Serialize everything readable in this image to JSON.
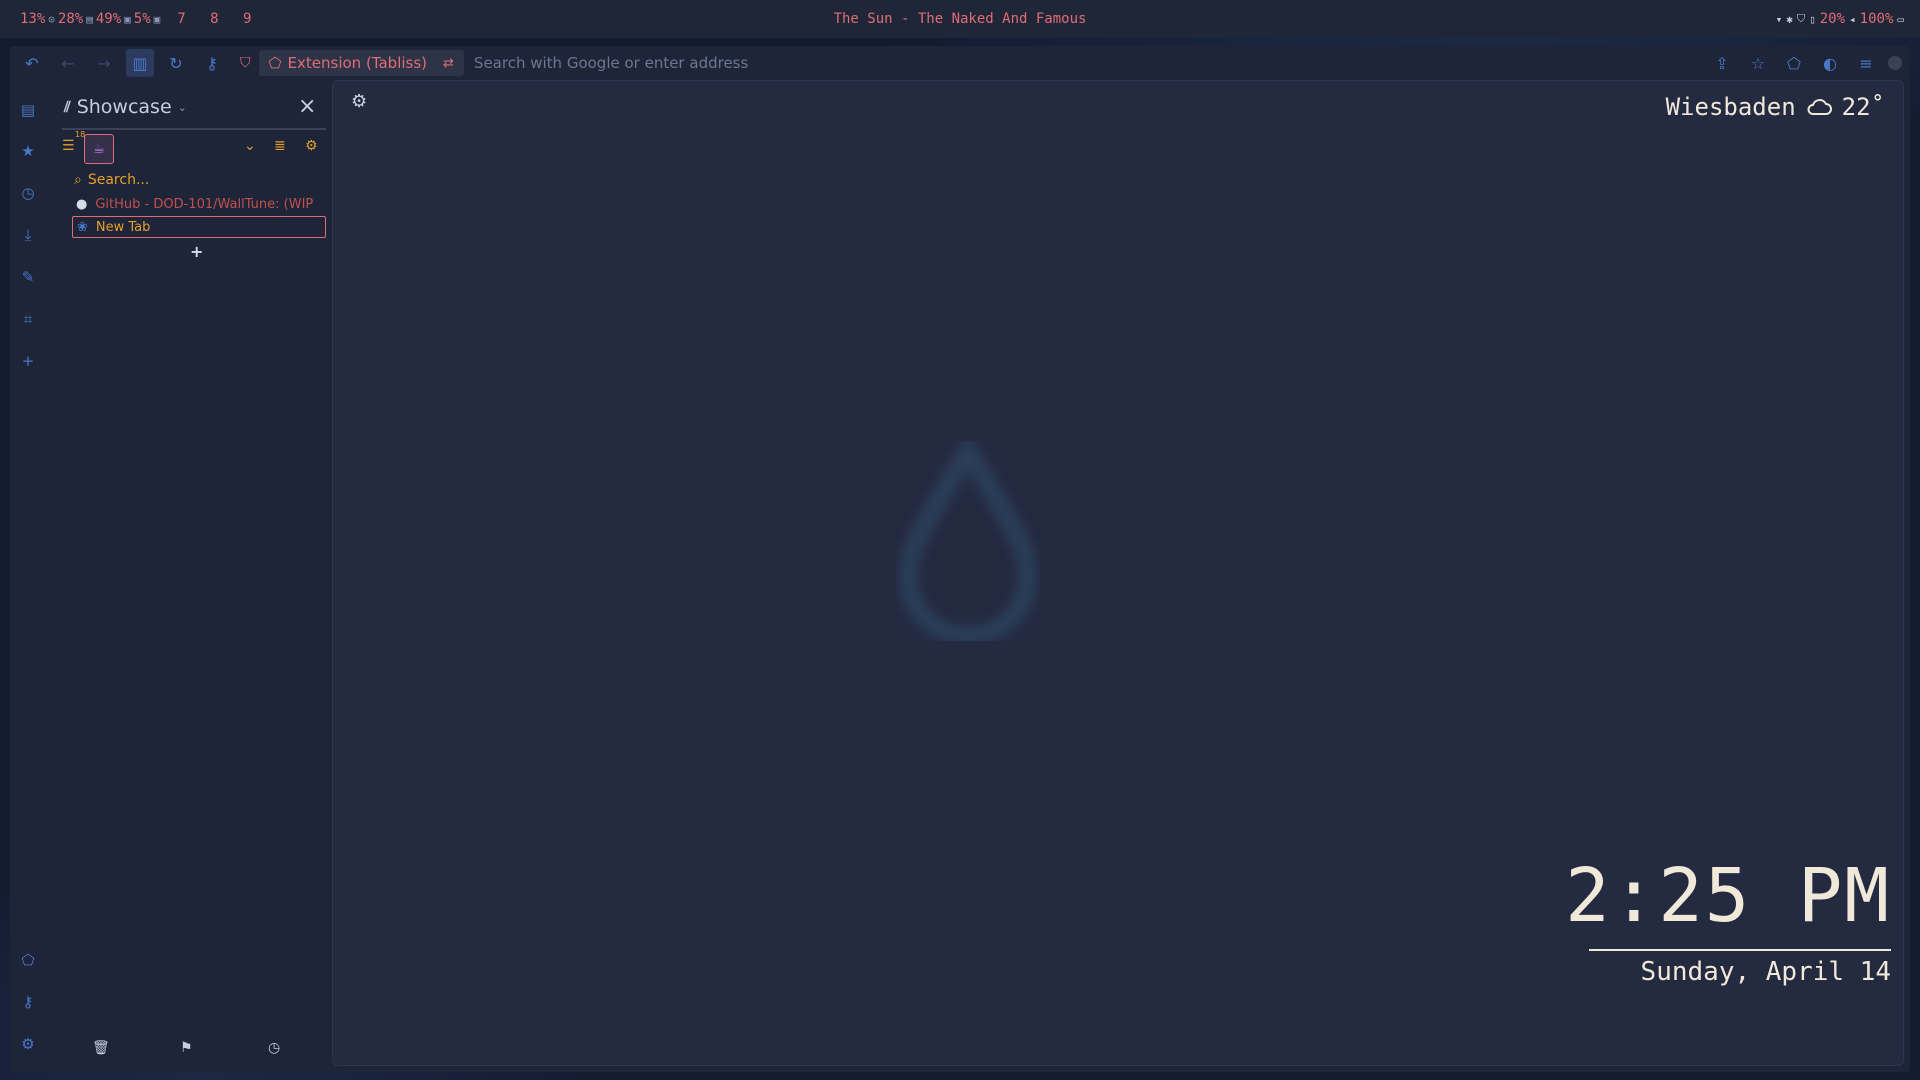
{
  "system_bar": {
    "cpu": "13%",
    "disk": "28%",
    "mem": "49%",
    "gpu": "5%",
    "workspaces": "7 8 9",
    "now_playing": "The Sun - The Naked And Famous",
    "brightness": "20%",
    "volume": "100%"
  },
  "browser": {
    "identity_label": "Extension (Tabliss)",
    "url_placeholder": "Search with Google or enter address"
  },
  "sidebar": {
    "title": "Showcase",
    "tab_count_badge": "18",
    "search_placeholder": "Search...",
    "tabs": [
      {
        "label": "GitHub - DOD-101/WallTune: (WIP",
        "icon": "github-icon"
      },
      {
        "label": "New Tab",
        "icon": "tabliss-icon",
        "active": true
      }
    ]
  },
  "newtab": {
    "weather": {
      "city": "Wiesbaden",
      "temp": "22˚",
      "condition_icon": "cloud-icon"
    },
    "time": "2:25 PM",
    "date": "Sunday, April 14"
  },
  "colors": {
    "accent_red": "#e06c75",
    "accent_blue": "#4a78c8",
    "accent_orange": "#e5a02a",
    "clock_text": "#f0e8d8"
  }
}
